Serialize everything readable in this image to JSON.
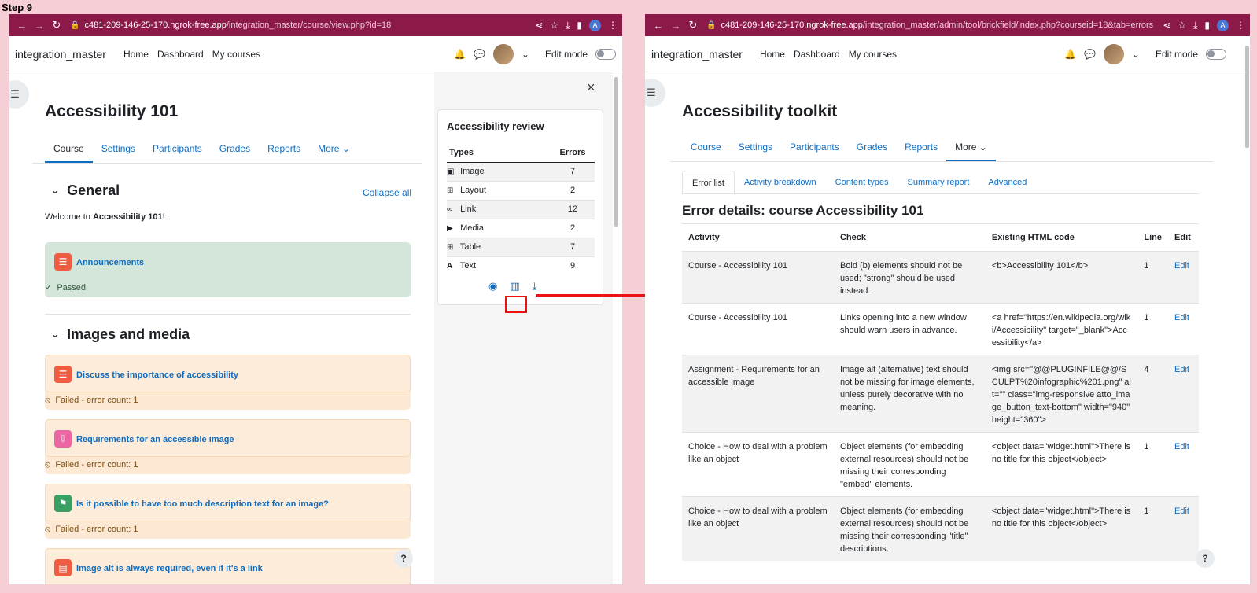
{
  "step_label": "Step 9",
  "left": {
    "url_host": "c481-209-146-25-170.ngrok-free.app",
    "url_path": "/integration_master/course/view.php?id=18",
    "site_name": "integration_master",
    "nav": [
      "Home",
      "Dashboard",
      "My courses"
    ],
    "edit_mode": "Edit mode",
    "course_title": "Accessibility 101",
    "tabs": [
      "Course",
      "Settings",
      "Participants",
      "Grades",
      "Reports",
      "More"
    ],
    "section_general": "General",
    "collapse_all": "Collapse all",
    "welcome_prefix": "Welcome to ",
    "welcome_bold": "Accessibility 101",
    "welcome_suffix": "!",
    "announcements": "Announcements",
    "passed": "Passed",
    "section_media": "Images and media",
    "activities": [
      {
        "name": "Discuss the importance of accessibility",
        "status": "Failed - error count: 1",
        "icon_color": "#f05c42"
      },
      {
        "name": "Requirements for an accessible image",
        "status": "Failed - error count: 1",
        "icon_color": "#eb66a2"
      },
      {
        "name": "Is it possible to have too much description text for an image?",
        "status": "Failed - error count: 1",
        "icon_color": "#399f62"
      },
      {
        "name": "Image alt is always required, even if it's a link",
        "status": "",
        "icon_color": "#f05c42"
      }
    ],
    "review": {
      "title": "Accessibility review",
      "col_types": "Types",
      "col_errors": "Errors",
      "rows": [
        {
          "type": "Image",
          "errors": "7",
          "icon": "image-icon"
        },
        {
          "type": "Layout",
          "errors": "2",
          "icon": "layout-icon"
        },
        {
          "type": "Link",
          "errors": "12",
          "icon": "link-icon"
        },
        {
          "type": "Media",
          "errors": "2",
          "icon": "media-icon"
        },
        {
          "type": "Table",
          "errors": "7",
          "icon": "table-icon"
        },
        {
          "type": "Text",
          "errors": "9",
          "icon": "text-icon"
        }
      ]
    },
    "close": "×",
    "help": "?"
  },
  "right": {
    "url_host": "c481-209-146-25-170.ngrok-free.app",
    "url_path": "/integration_master/admin/tool/brickfield/index.php?courseid=18&tab=errors",
    "site_name": "integration_master",
    "nav": [
      "Home",
      "Dashboard",
      "My courses"
    ],
    "edit_mode": "Edit mode",
    "page_title": "Accessibility toolkit",
    "tabs": [
      "Course",
      "Settings",
      "Participants",
      "Grades",
      "Reports",
      "More"
    ],
    "subtabs": [
      "Error list",
      "Activity breakdown",
      "Content types",
      "Summary report",
      "Advanced"
    ],
    "heading": "Error details: course Accessibility 101",
    "columns": [
      "Activity",
      "Check",
      "Existing HTML code",
      "Line",
      "Edit"
    ],
    "rows": [
      {
        "activity": "Course - Accessibility 101",
        "check": "Bold (b) elements should not be used; \"strong\" should be used instead.",
        "code": "<b>Accessibility 101</b>",
        "line": "1",
        "edit": "Edit"
      },
      {
        "activity": "Course - Accessibility 101",
        "check": "Links opening into a new window should warn users in advance.",
        "code": "<a href=\"https://en.wikipedia.org/wiki/Accessibility\" target=\"_blank\">Accessibility</a>",
        "line": "1",
        "edit": "Edit"
      },
      {
        "activity": "Assignment - Requirements for an accessible image",
        "check": "Image alt (alternative) text should not be missing for image elements, unless purely decorative with no meaning.",
        "code": "<img src=\"@@PLUGINFILE@@/SCULPT%20infographic%201.png\" alt=\"\" class=\"img-responsive atto_image_button_text-bottom\" width=\"940\" height=\"360\">",
        "line": "4",
        "edit": "Edit"
      },
      {
        "activity": "Choice - How to deal with a problem like an object",
        "check": "Object elements (for embedding external resources) should not be missing their corresponding \"embed\" elements.",
        "code": "<object data=\"widget.html\">There is no title for this object</object>",
        "line": "1",
        "edit": "Edit"
      },
      {
        "activity": "Choice - How to deal with a problem like an object",
        "check": "Object elements (for embedding external resources) should not be missing their corresponding \"title\" descriptions.",
        "code": "<object data=\"widget.html\">There is no title for this object</object>",
        "line": "1",
        "edit": "Edit"
      }
    ],
    "help": "?"
  }
}
